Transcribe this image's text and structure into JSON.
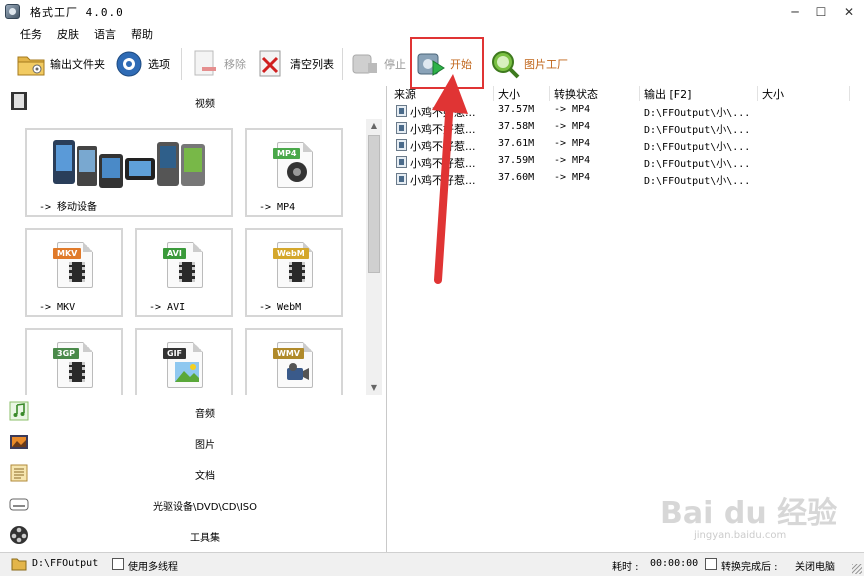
{
  "window": {
    "title": "格式工厂 4.0.0",
    "minimize_glyph": "─",
    "maximize_glyph": "☐",
    "close_glyph": "✕"
  },
  "menu": [
    "任务",
    "皮肤",
    "语言",
    "帮助"
  ],
  "toolbar": {
    "output_folder": "输出文件夹",
    "options": "选项",
    "remove": "移除",
    "clear_list": "清空列表",
    "stop": "停止",
    "start": "开始",
    "image_factory": "图片工厂"
  },
  "categories": {
    "video": "视频",
    "audio": "音频",
    "image": "图片",
    "document": "文档",
    "disc": "光驱设备\\DVD\\CD\\ISO",
    "tools": "工具集"
  },
  "tiles": [
    {
      "label": "-> 移动设备",
      "icon": "mobile-devices-icon"
    },
    {
      "label": "-> MP4",
      "tag": "MP4",
      "icon": "mp4-file-icon"
    },
    {
      "label": "-> MKV",
      "tag": "MKV",
      "icon": "mkv-file-icon"
    },
    {
      "label": "-> AVI",
      "tag": "AVI",
      "icon": "avi-file-icon"
    },
    {
      "label": "-> WebM",
      "tag": "WebM",
      "icon": "webm-file-icon"
    },
    {
      "label": "",
      "tag": "3GP",
      "icon": "3gp-file-icon"
    },
    {
      "label": "",
      "tag": "GIF",
      "icon": "gif-file-icon"
    },
    {
      "label": "",
      "tag": "WMV",
      "icon": "wmv-file-icon"
    }
  ],
  "table": {
    "headers": [
      "来源",
      "大小",
      "转换状态",
      "输出 [F2]",
      "大小"
    ],
    "rows": [
      {
        "source": "小鸡不好惹...",
        "size": "37.57M",
        "status": "-> MP4",
        "output": "D:\\FFOutput\\小\\..."
      },
      {
        "source": "小鸡不好惹...",
        "size": "37.58M",
        "status": "-> MP4",
        "output": "D:\\FFOutput\\小\\..."
      },
      {
        "source": "小鸡不好惹...",
        "size": "37.61M",
        "status": "-> MP4",
        "output": "D:\\FFOutput\\小\\..."
      },
      {
        "source": "小鸡不好惹...",
        "size": "37.59M",
        "status": "-> MP4",
        "output": "D:\\FFOutput\\小\\..."
      },
      {
        "source": "小鸡不好惹...",
        "size": "37.60M",
        "status": "-> MP4",
        "output": "D:\\FFOutput\\小\\..."
      }
    ]
  },
  "statusbar": {
    "output_path": "D:\\FFOutput",
    "multithread": "使用多线程",
    "elapsed_label": "耗时 :",
    "elapsed_value": "00:00:00",
    "after_convert": "转换完成后 :",
    "shutdown": "关闭电脑"
  },
  "colors": {
    "highlight_box": "#e03434",
    "annotation_arrow": "#e03434"
  },
  "watermark": {
    "brand": "Bai du 经验",
    "url": "jingyan.baidu.com"
  }
}
